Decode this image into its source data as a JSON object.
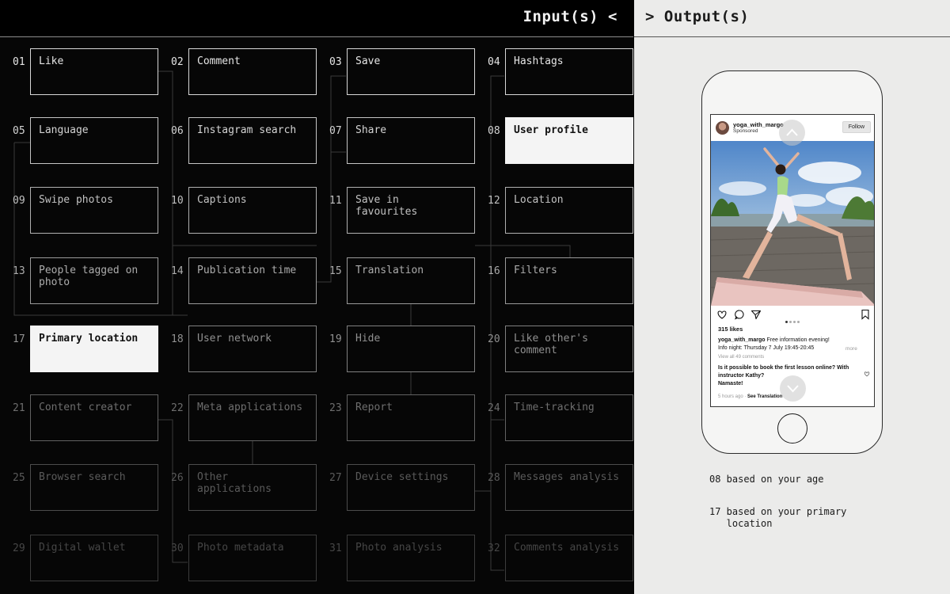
{
  "header": {
    "input_title": "Input(s) <",
    "output_title": "> Output(s)"
  },
  "inputs": [
    {
      "num": "01",
      "label": "Like"
    },
    {
      "num": "02",
      "label": "Comment"
    },
    {
      "num": "03",
      "label": "Save"
    },
    {
      "num": "04",
      "label": "Hashtags"
    },
    {
      "num": "05",
      "label": "Language"
    },
    {
      "num": "06",
      "label": "Instagram search"
    },
    {
      "num": "07",
      "label": "Share"
    },
    {
      "num": "08",
      "label": "User profile",
      "selected": true
    },
    {
      "num": "09",
      "label": "Swipe photos"
    },
    {
      "num": "10",
      "label": "Captions"
    },
    {
      "num": "11",
      "label": "Save in favourites"
    },
    {
      "num": "12",
      "label": "Location"
    },
    {
      "num": "13",
      "label": "People tagged on photo"
    },
    {
      "num": "14",
      "label": "Publication time"
    },
    {
      "num": "15",
      "label": "Translation"
    },
    {
      "num": "16",
      "label": "Filters"
    },
    {
      "num": "17",
      "label": "Primary location",
      "selected": true
    },
    {
      "num": "18",
      "label": "User network"
    },
    {
      "num": "19",
      "label": "Hide"
    },
    {
      "num": "20",
      "label": "Like other's comment"
    },
    {
      "num": "21",
      "label": "Content creator"
    },
    {
      "num": "22",
      "label": "Meta applications"
    },
    {
      "num": "23",
      "label": "Report"
    },
    {
      "num": "24",
      "label": "Time-tracking"
    },
    {
      "num": "25",
      "label": "Browser search"
    },
    {
      "num": "26",
      "label": "Other applications"
    },
    {
      "num": "27",
      "label": "Device settings"
    },
    {
      "num": "28",
      "label": "Messages analysis"
    },
    {
      "num": "29",
      "label": "Digital wallet"
    },
    {
      "num": "30",
      "label": "Photo metadata"
    },
    {
      "num": "31",
      "label": "Photo analysis"
    },
    {
      "num": "32",
      "label": "Comments analysis"
    }
  ],
  "post": {
    "username": "yoga_with_margo",
    "sponsored": "Sponsored",
    "follow_label": "Follow",
    "likes": "315 likes",
    "caption_user": "yoga_with_margo",
    "caption_text": " Free information evening!",
    "caption_line2": "Info night: Thursday 7 July 19:45-20:45",
    "more_label": "more",
    "view_all": "View all 49 comments",
    "comment_line1": "Is it possible to book the first lesson online? With",
    "comment_line2": "instructor Kathy?",
    "comment_line3": "Namaste!",
    "time_ago": "5 hours ago · ",
    "see_translation": "See Translation",
    "carousel_count": 4,
    "carousel_active": 0
  },
  "outputs": [
    {
      "text": "08 based on your age"
    },
    {
      "text": "17 based on your primary\n   location"
    }
  ],
  "colors": {
    "left_bg": "#060606",
    "right_bg": "#ebebea",
    "highlight": "#f4f4f4"
  }
}
